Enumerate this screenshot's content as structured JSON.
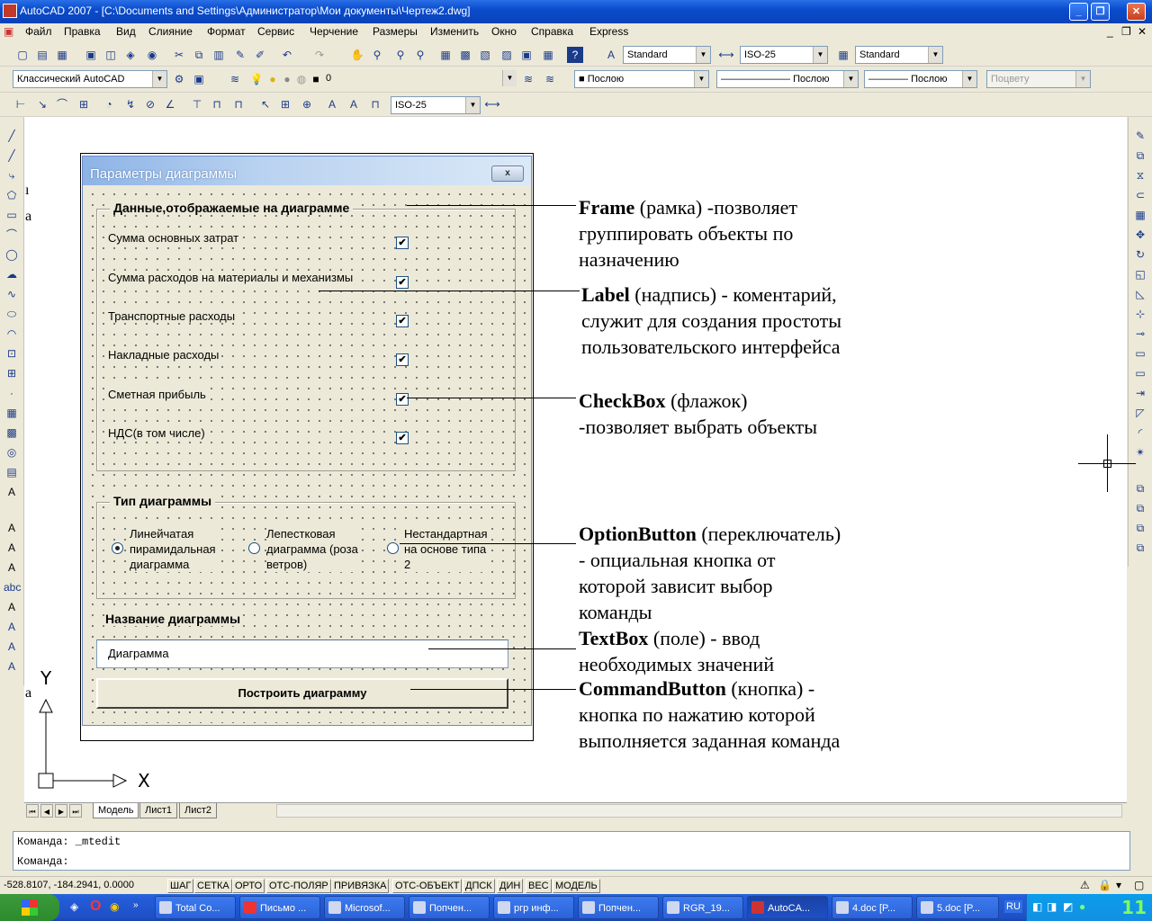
{
  "window": {
    "title": "AutoCAD 2007 - [C:\\Documents and Settings\\Администратор\\Мои документы\\Чертеж2.dwg]"
  },
  "menu": [
    "Файл",
    "Правка",
    "Вид",
    "Слияние",
    "Формат",
    "Сервис",
    "Черчение",
    "Размеры",
    "Изменить",
    "Окно",
    "Справка",
    "Express"
  ],
  "toolbar1": {
    "text_style": "Standard",
    "dim_style": "ISO-25",
    "table_style": "Standard"
  },
  "toolbar2": {
    "workspace": "Классический AutoCAD",
    "layer": "0",
    "color": "Послою",
    "linetype": "Послою",
    "lineweight": "Послою",
    "plotstyle": "Поцвету"
  },
  "toolbar3": {
    "dim_style": "ISO-25"
  },
  "form": {
    "title": "Параметры диаграммы",
    "close": "x",
    "frame1_caption": "Данные,отображаемые на диаграмме",
    "items": [
      "Сумма основных затрат",
      "Сумма расходов на материалы и механизмы",
      "Транспортные расходы",
      "Накладные расходы",
      "Сметная прибыль",
      "НДС(в том числе)"
    ],
    "frame2_caption": "Тип диаграммы",
    "options": [
      {
        "line1": "Линейчатая",
        "line2": "пирамидальная",
        "line3": "диаграмма",
        "selected": true
      },
      {
        "line1": "Лепестковая",
        "line2": "диаграмма (роза",
        "line3": "ветров)",
        "selected": false
      },
      {
        "line1": "Нестандартная",
        "line2": "на основе типа",
        "line3": "2",
        "selected": false
      }
    ],
    "name_label": "Название диаграммы",
    "name_value": "Диаграмма",
    "build_button": "Построить диаграмму"
  },
  "annotations": {
    "frame": {
      "term": "Frame",
      "l1": " (рамка) -позволяет",
      "l2": "группировать объекты по",
      "l3": "назначению"
    },
    "label": {
      "term": "Label",
      "l1": " (надпись) - коментарий,",
      "l2": "служит для создания простоты",
      "l3": "пользовательского интерфейса"
    },
    "checkbox": {
      "term": "CheckBox",
      "l1": " (флажок)",
      "l2": "-позволяет выбрать объекты"
    },
    "option": {
      "term": "OptionButton",
      "l1": " (переключатель)",
      "l2": "- опциальная кнопка от",
      "l3": "которой зависит выбор",
      "l4": "команды"
    },
    "textbox": {
      "term": "TextBox",
      "l1": " (поле) - ввод",
      "l2": "необходимых значений"
    },
    "command": {
      "term": "CommandButton",
      "l1": " (кнопка) -",
      "l2": "кнопка по нажатию которой",
      "l3": "выполняется заданная команда"
    }
  },
  "axis": {
    "y": "Y",
    "x": "X"
  },
  "layout_tabs": [
    "Модель",
    "Лист1",
    "Лист2"
  ],
  "command": {
    "line1": "Команда:  _mtedit",
    "line2": "Команда:"
  },
  "status": {
    "coords": "-528.8107, -184.2941, 0.0000",
    "buttons": [
      "ШАГ",
      "СЕТКА",
      "ОРТО",
      "ОТС-ПОЛЯР",
      "ПРИВЯЗКА",
      "ОТС-ОБЪЕКТ",
      "ДПСК",
      "ДИН",
      "ВЕС",
      "МОДЕЛЬ"
    ]
  },
  "taskbar": {
    "tasks": [
      "Total Co...",
      "Письмо ...",
      "Microsof...",
      "Попчен...",
      "ргр инф...",
      "Попчен...",
      "RGR_19...",
      "AutoCA...",
      "4.doc [P...",
      "5.doc [P..."
    ],
    "lang": "RU",
    "clock": "11"
  }
}
